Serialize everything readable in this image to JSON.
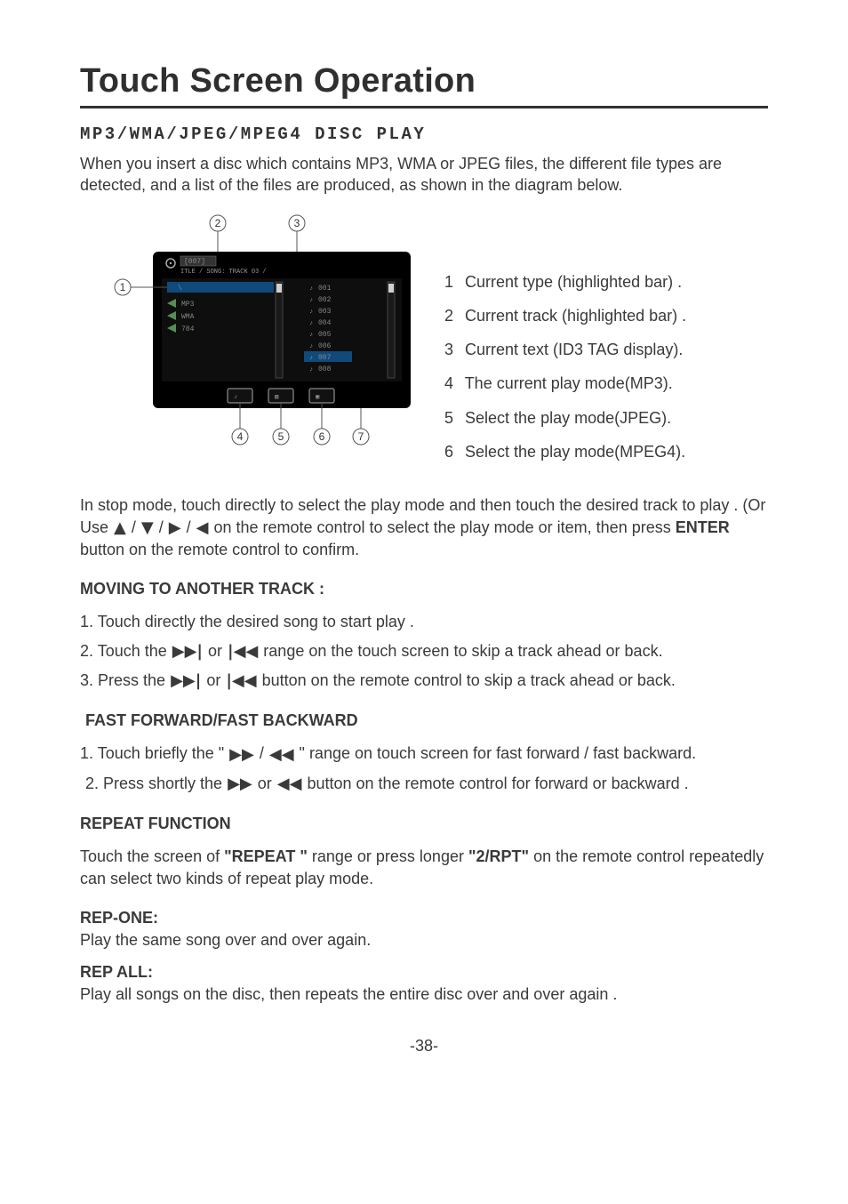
{
  "title": "Touch Screen Operation",
  "section_heading": "MP3/WMA/JPEG/MPEG4 DISC PLAY",
  "intro": "When you insert a disc which contains MP3, WMA or JPEG files, the different file types are detected, and a list of the files are produced, as shown in the diagram below.",
  "diagram": {
    "callouts": [
      "1",
      "2",
      "3",
      "4",
      "5",
      "6",
      "7"
    ],
    "folder_label": "[007]",
    "track_header": "ITLE / SONG:  TRACK  03 /",
    "root_label": "\\",
    "type_items": [
      "MP3",
      "WMA",
      "784"
    ],
    "track_list": [
      "001",
      "002",
      "003",
      "004",
      "005",
      "006",
      "007",
      "008"
    ]
  },
  "legend": [
    {
      "n": "1",
      "text": "Current type (highlighted bar) ."
    },
    {
      "n": "2",
      "text": "Current track (highlighted bar) ."
    },
    {
      "n": "3",
      "text": "Current text (ID3 TAG display)."
    },
    {
      "n": "4",
      "text": "The current play mode(MP3)."
    },
    {
      "n": "5",
      "text": "Select the play mode(JPEG)."
    },
    {
      "n": "6",
      "text": "Select the play mode(MPEG4)."
    }
  ],
  "stop_mode_para_parts": {
    "a": "In stop mode,  touch directly  to select the play mode and then touch the desired track to play . (Or  Use  ",
    "b": "   on the remote control to select the play mode or item, then  press ",
    "enter": "ENTER",
    "c": " button on the remote control to confirm."
  },
  "moving_heading": "MOVING TO ANOTHER TRACK :",
  "moving_items": {
    "l1": "1. Touch directly the desired song to start play .",
    "l2a": "2. Touch the  ",
    "l2b": " or ",
    "l2c": " range on the touch screen to skip a track ahead or back.",
    "l3a": "3. Press the  ",
    "l3b": " or ",
    "l3c": "  button on the remote control to skip a track ahead or back."
  },
  "ff_heading": "FAST FORWARD/FAST BACKWARD",
  "ff_items": {
    "l1a": "1. Touch briefly the \" ",
    "l1b": "  /  ",
    "l1c": " \" range on touch screen for fast forward / fast backward.",
    "l2a": "2. Press shortly the  ",
    "l2b": " or ",
    "l2c": " button on the remote control for forward or backward ."
  },
  "repeat_heading": "REPEAT FUNCTION",
  "repeat_para": {
    "a": "Touch the screen of ",
    "b": "\"REPEAT \"",
    "c": " range or press longer ",
    "d": "\"2/RPT\"",
    "e": "  on the remote control repeatedly can select two kinds of repeat play mode."
  },
  "rep_one_h": "REP-ONE:",
  "rep_one_t": "Play the same song over and over again.",
  "rep_all_h": "REP ALL:",
  "rep_all_t": "Play all songs on the disc, then repeats the entire disc over and over again .",
  "page_no": "-38-",
  "icons": {
    "next_track": "▶▶|",
    "prev_track": "|◀◀",
    "ffwd": "▶▶",
    "rew": "◀◀",
    "up": "▲",
    "down": "▼",
    "right": "▶",
    "left": "◀",
    "sep": " / "
  }
}
